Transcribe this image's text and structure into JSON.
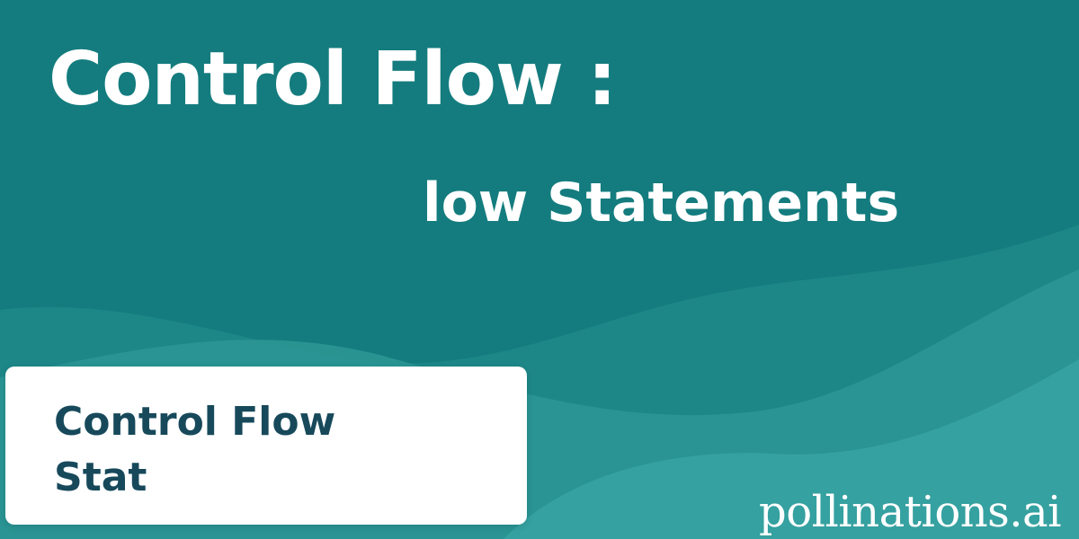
{
  "header": {
    "title": "Control Flow :",
    "subtitle": "low Statements"
  },
  "card": {
    "line1": "Control Flow",
    "line2": "Stat"
  },
  "watermark": {
    "text": "pollinations.ai"
  },
  "colors": {
    "background": "#147c7e",
    "wave_light": "#3aa5a4",
    "wave_mid": "#268f8f",
    "title_text": "#ffffff",
    "card_background": "#ffffff",
    "card_text": "#17495b"
  }
}
